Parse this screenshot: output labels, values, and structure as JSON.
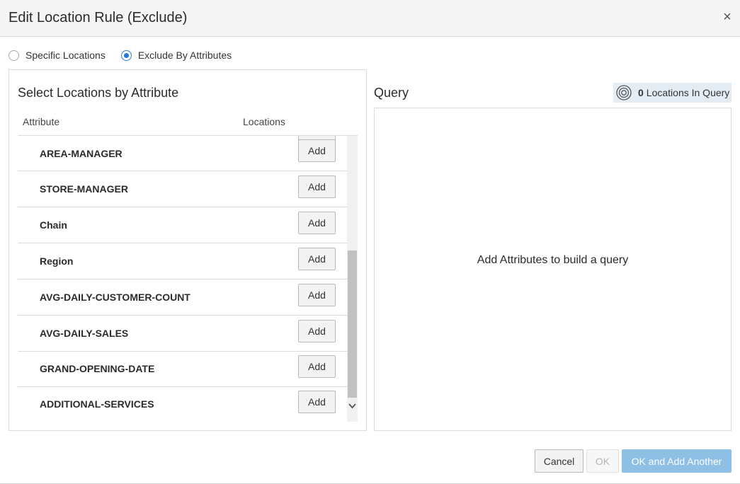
{
  "dialog": {
    "title": "Edit Location Rule (Exclude)",
    "close_glyph": "×"
  },
  "mode": {
    "options": [
      {
        "label": "Specific Locations",
        "selected": false
      },
      {
        "label": "Exclude By Attributes",
        "selected": true
      }
    ]
  },
  "attributes_panel": {
    "title": "Select Locations by Attribute",
    "columns": [
      "Attribute",
      "Locations"
    ],
    "rows": [
      {
        "label": "AREA-MANAGER",
        "button": "Add"
      },
      {
        "label": "STORE-MANAGER",
        "button": "Add"
      },
      {
        "label": "Chain",
        "button": "Add"
      },
      {
        "label": "Region",
        "button": "Add"
      },
      {
        "label": "AVG-DAILY-CUSTOMER-COUNT",
        "button": "Add"
      },
      {
        "label": "AVG-DAILY-SALES",
        "button": "Add"
      },
      {
        "label": "GRAND-OPENING-DATE",
        "button": "Add"
      },
      {
        "label": "ADDITIONAL-SERVICES",
        "button": "Add"
      }
    ],
    "scroll_arrow_glyph": "⌄"
  },
  "query": {
    "title": "Query",
    "count": "0",
    "count_label": "Locations In Query",
    "icon": "target-icon",
    "empty_message": "Add Attributes to build a query"
  },
  "footer": {
    "cancel_label": "Cancel",
    "ok_label": "OK",
    "ok_add_label": "OK and Add Another"
  },
  "colors": {
    "accent": "#227ad6",
    "primary_disabled": "#8ec0e6",
    "badge_bg": "#e4edf4"
  }
}
